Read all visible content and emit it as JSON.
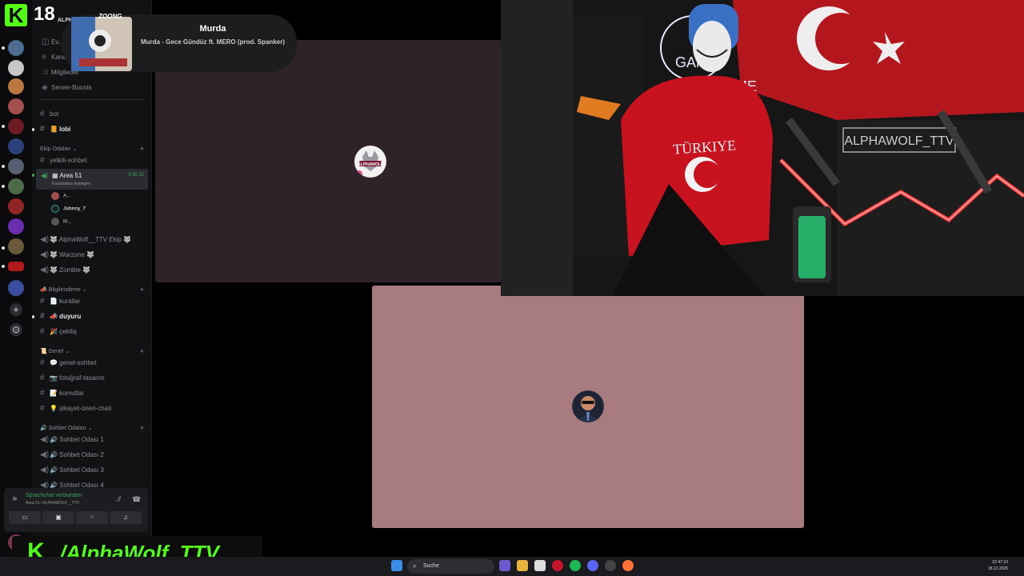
{
  "overlay": {
    "badge": "18",
    "k_letter": "K"
  },
  "now_playing": {
    "title": "Murda",
    "subtitle": "Murda - Gece Gündüz ft. MERO (prod. Spanker)",
    "cover_label": "ZOONG"
  },
  "server_name_fragment": "ALPHA",
  "sidebar": {
    "top_items": [
      {
        "label": "Ev..."
      },
      {
        "label": "Kana..."
      },
      {
        "label": "Mitglieder"
      },
      {
        "label": "Server-Boosts"
      }
    ],
    "channels_top": [
      {
        "label": "bot"
      },
      {
        "label": "📙 lobi"
      }
    ],
    "cat_ekip": "Ekip Odaları",
    "yetkili": "yetkili-sohbet",
    "active_channel": {
      "name": "Area 51",
      "timer": "3:40:12",
      "status": "Kanalstatus festlegen"
    },
    "voice_users": [
      "A...",
      "Johnny_7",
      "M..."
    ],
    "voice_channels_ekip": [
      {
        "label": "🐺 AlphaWolf__TTV Ekip 🐺"
      },
      {
        "label": "🐺 Warzone 🐺"
      },
      {
        "label": "🐺 Zombie 🐺"
      }
    ],
    "cat_bilgi": "Bilgilendirme",
    "channels_bilgi": [
      {
        "label": "📄 kurallar"
      },
      {
        "label": "📣 duyuru"
      },
      {
        "label": "🎉 çekiliş"
      }
    ],
    "cat_genel": "Genel",
    "channels_genel": [
      {
        "label": "💬 genel-sohbet"
      },
      {
        "label": "📷 fotoğraf-tasarım"
      },
      {
        "label": "📝 komutlar"
      },
      {
        "label": "💡 şikayet-öneri-chati"
      }
    ],
    "cat_sohbet": "Sohbet Odaları",
    "channels_sohbet": [
      {
        "label": "🔊 Sohbet Odası 1"
      },
      {
        "label": "🔊 Sohbet Odası 2"
      },
      {
        "label": "🔊 Sohbet Odası 3"
      },
      {
        "label": "🔊 Sohbet Odası 4"
      }
    ]
  },
  "voice_panel": {
    "status": "Sprachchat verbunden",
    "sub": "Area 51 / ALPHAWOLF__TTV"
  },
  "stream": {
    "handle": "/AlphaWolf_TTV"
  },
  "webcam": {
    "shirt_text": "TÜRKIYE",
    "sign": "ALPHAWOLF_TTV",
    "neon": "GAME",
    "neon2": "IME"
  },
  "taskbar": {
    "search": "Suche",
    "time": "02:47:10",
    "date": "18.12.2025"
  },
  "tile1_logo": "ALPHAWOLF"
}
